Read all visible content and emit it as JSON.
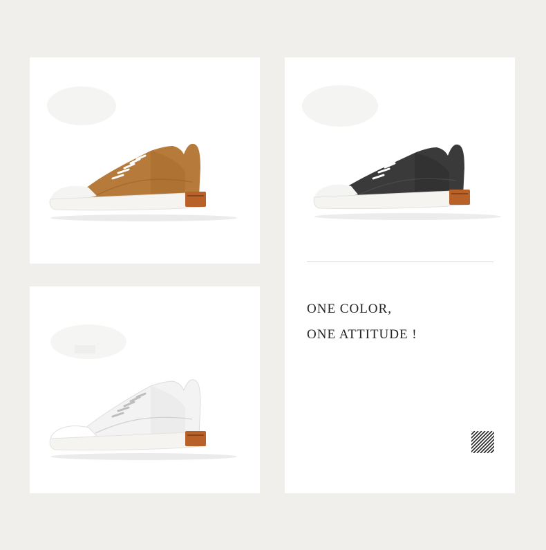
{
  "colors": {
    "background": "#f0efeb",
    "panel": "#ffffff",
    "tan_upper": "#b67a3a",
    "black_upper": "#3a3a3a",
    "white_upper": "#f3f3f3",
    "sole": "#f5f4f0",
    "heel_block": "#b8622a",
    "text": "#222222"
  },
  "products": [
    {
      "color_name": "tan",
      "icon": "tan-sneaker-icon"
    },
    {
      "color_name": "black",
      "icon": "black-sneaker-icon"
    },
    {
      "color_name": "white",
      "icon": "white-sneaker-icon"
    }
  ],
  "tagline": {
    "line1": "ONE COLOR,",
    "line2": "ONE ATTITUDE !"
  },
  "decor": {
    "icon": "diagonal-stripes-icon"
  }
}
